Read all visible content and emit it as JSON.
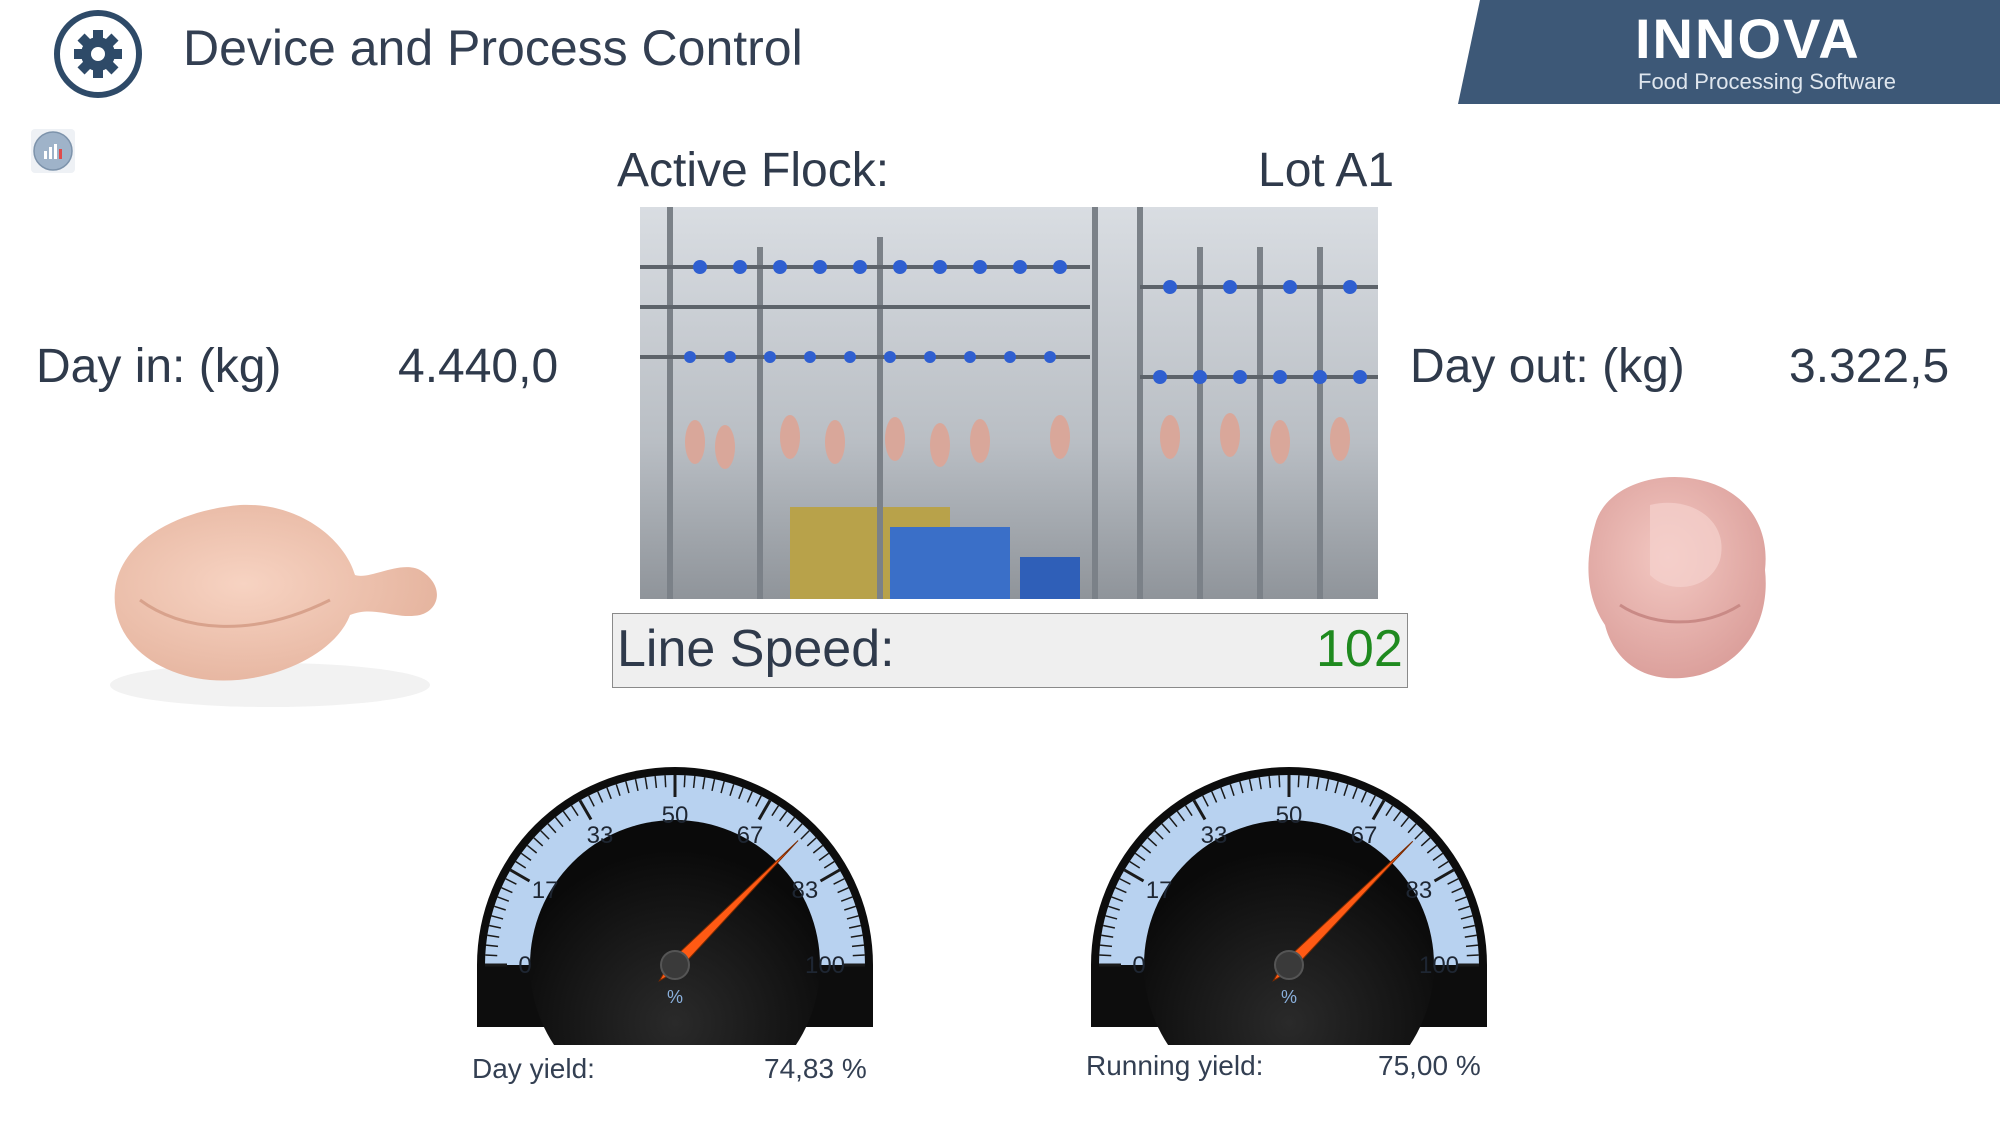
{
  "header": {
    "title": "Device and Process Control",
    "settings_icon": "gear-icon",
    "report_icon": "bar-chart-icon"
  },
  "brand": {
    "name": "INNOVA",
    "tagline": "Food Processing Software",
    "banner_color": "#3d5877"
  },
  "flock": {
    "label": "Active Flock:",
    "value": "Lot A1"
  },
  "line_speed": {
    "label": "Line Speed:",
    "value": "102",
    "value_color": "#1f8a1f"
  },
  "day_in": {
    "label": "Day in: (kg)",
    "value": "4.440,0"
  },
  "day_out": {
    "label": "Day out: (kg)",
    "value": "3.322,5"
  },
  "gauges": [
    {
      "id": "day",
      "label": "Day yield:",
      "value_text": "74,83 %",
      "value": 74.83,
      "min": 0,
      "max": 100,
      "ticks": [
        "0",
        "17",
        "33",
        "50",
        "67",
        "83",
        "100"
      ],
      "unit": "%"
    },
    {
      "id": "running",
      "label": "Running yield:",
      "value_text": "75,00 %",
      "value": 75.0,
      "min": 0,
      "max": 100,
      "ticks": [
        "0",
        "17",
        "33",
        "50",
        "67",
        "83",
        "100"
      ],
      "unit": "%"
    }
  ],
  "colors": {
    "gauge_ring": "#b8d2f0",
    "gauge_needle": "#ff5a14",
    "gauge_face": "#0a0a0a",
    "text": "#333f52"
  }
}
